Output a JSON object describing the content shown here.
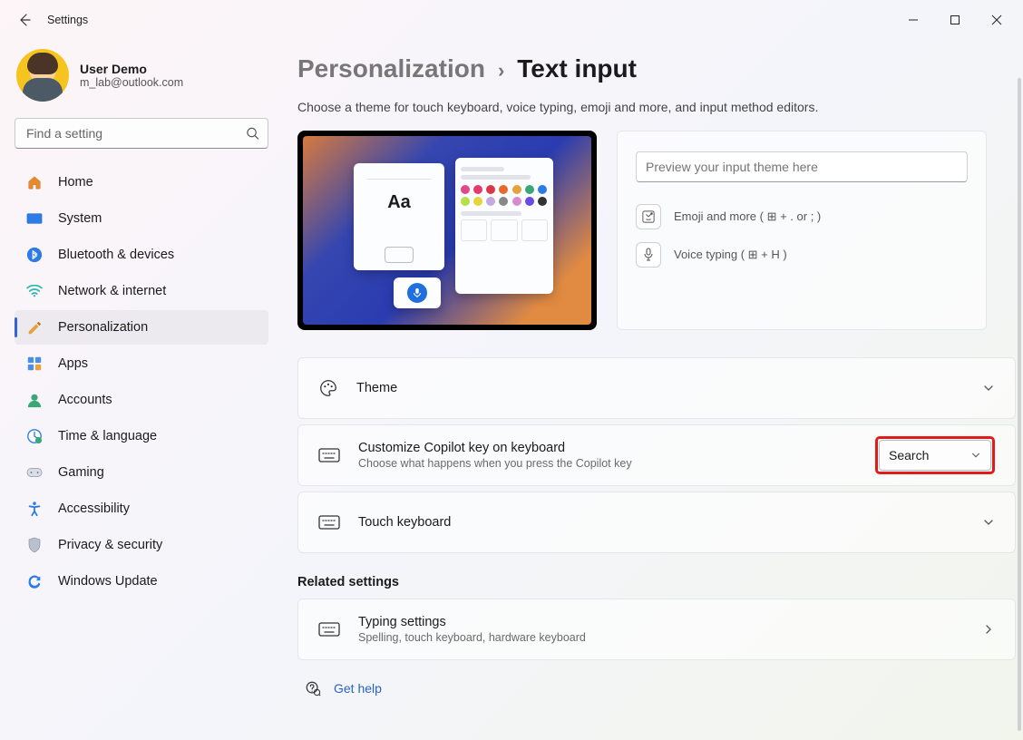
{
  "titlebar": {
    "app": "Settings"
  },
  "user": {
    "name": "User Demo",
    "email": "m_lab@outlook.com"
  },
  "search": {
    "placeholder": "Find a setting"
  },
  "nav": {
    "home": "Home",
    "system": "System",
    "bluetooth": "Bluetooth & devices",
    "network": "Network & internet",
    "personalization": "Personalization",
    "apps": "Apps",
    "accounts": "Accounts",
    "time": "Time & language",
    "gaming": "Gaming",
    "accessibility": "Accessibility",
    "privacy": "Privacy & security",
    "update": "Windows Update"
  },
  "breadcrumb": {
    "parent": "Personalization",
    "current": "Text input"
  },
  "description": "Choose a theme for touch keyboard, voice typing, emoji and more, and input method editors.",
  "preview": {
    "input_placeholder": "Preview your input theme here",
    "emoji_label": "Emoji and more ( ⊞ + . or ; )",
    "voice_label": "Voice typing ( ⊞ + H )"
  },
  "settings": {
    "theme": {
      "title": "Theme"
    },
    "copilot": {
      "title": "Customize Copilot key on keyboard",
      "sub": "Choose what happens when you press the Copilot key",
      "value": "Search"
    },
    "touch_keyboard": {
      "title": "Touch keyboard"
    }
  },
  "related": {
    "heading": "Related settings",
    "typing": {
      "title": "Typing settings",
      "sub": "Spelling, touch keyboard, hardware keyboard"
    }
  },
  "help": {
    "label": "Get help"
  },
  "symbols": {
    "aa": "Aa"
  }
}
